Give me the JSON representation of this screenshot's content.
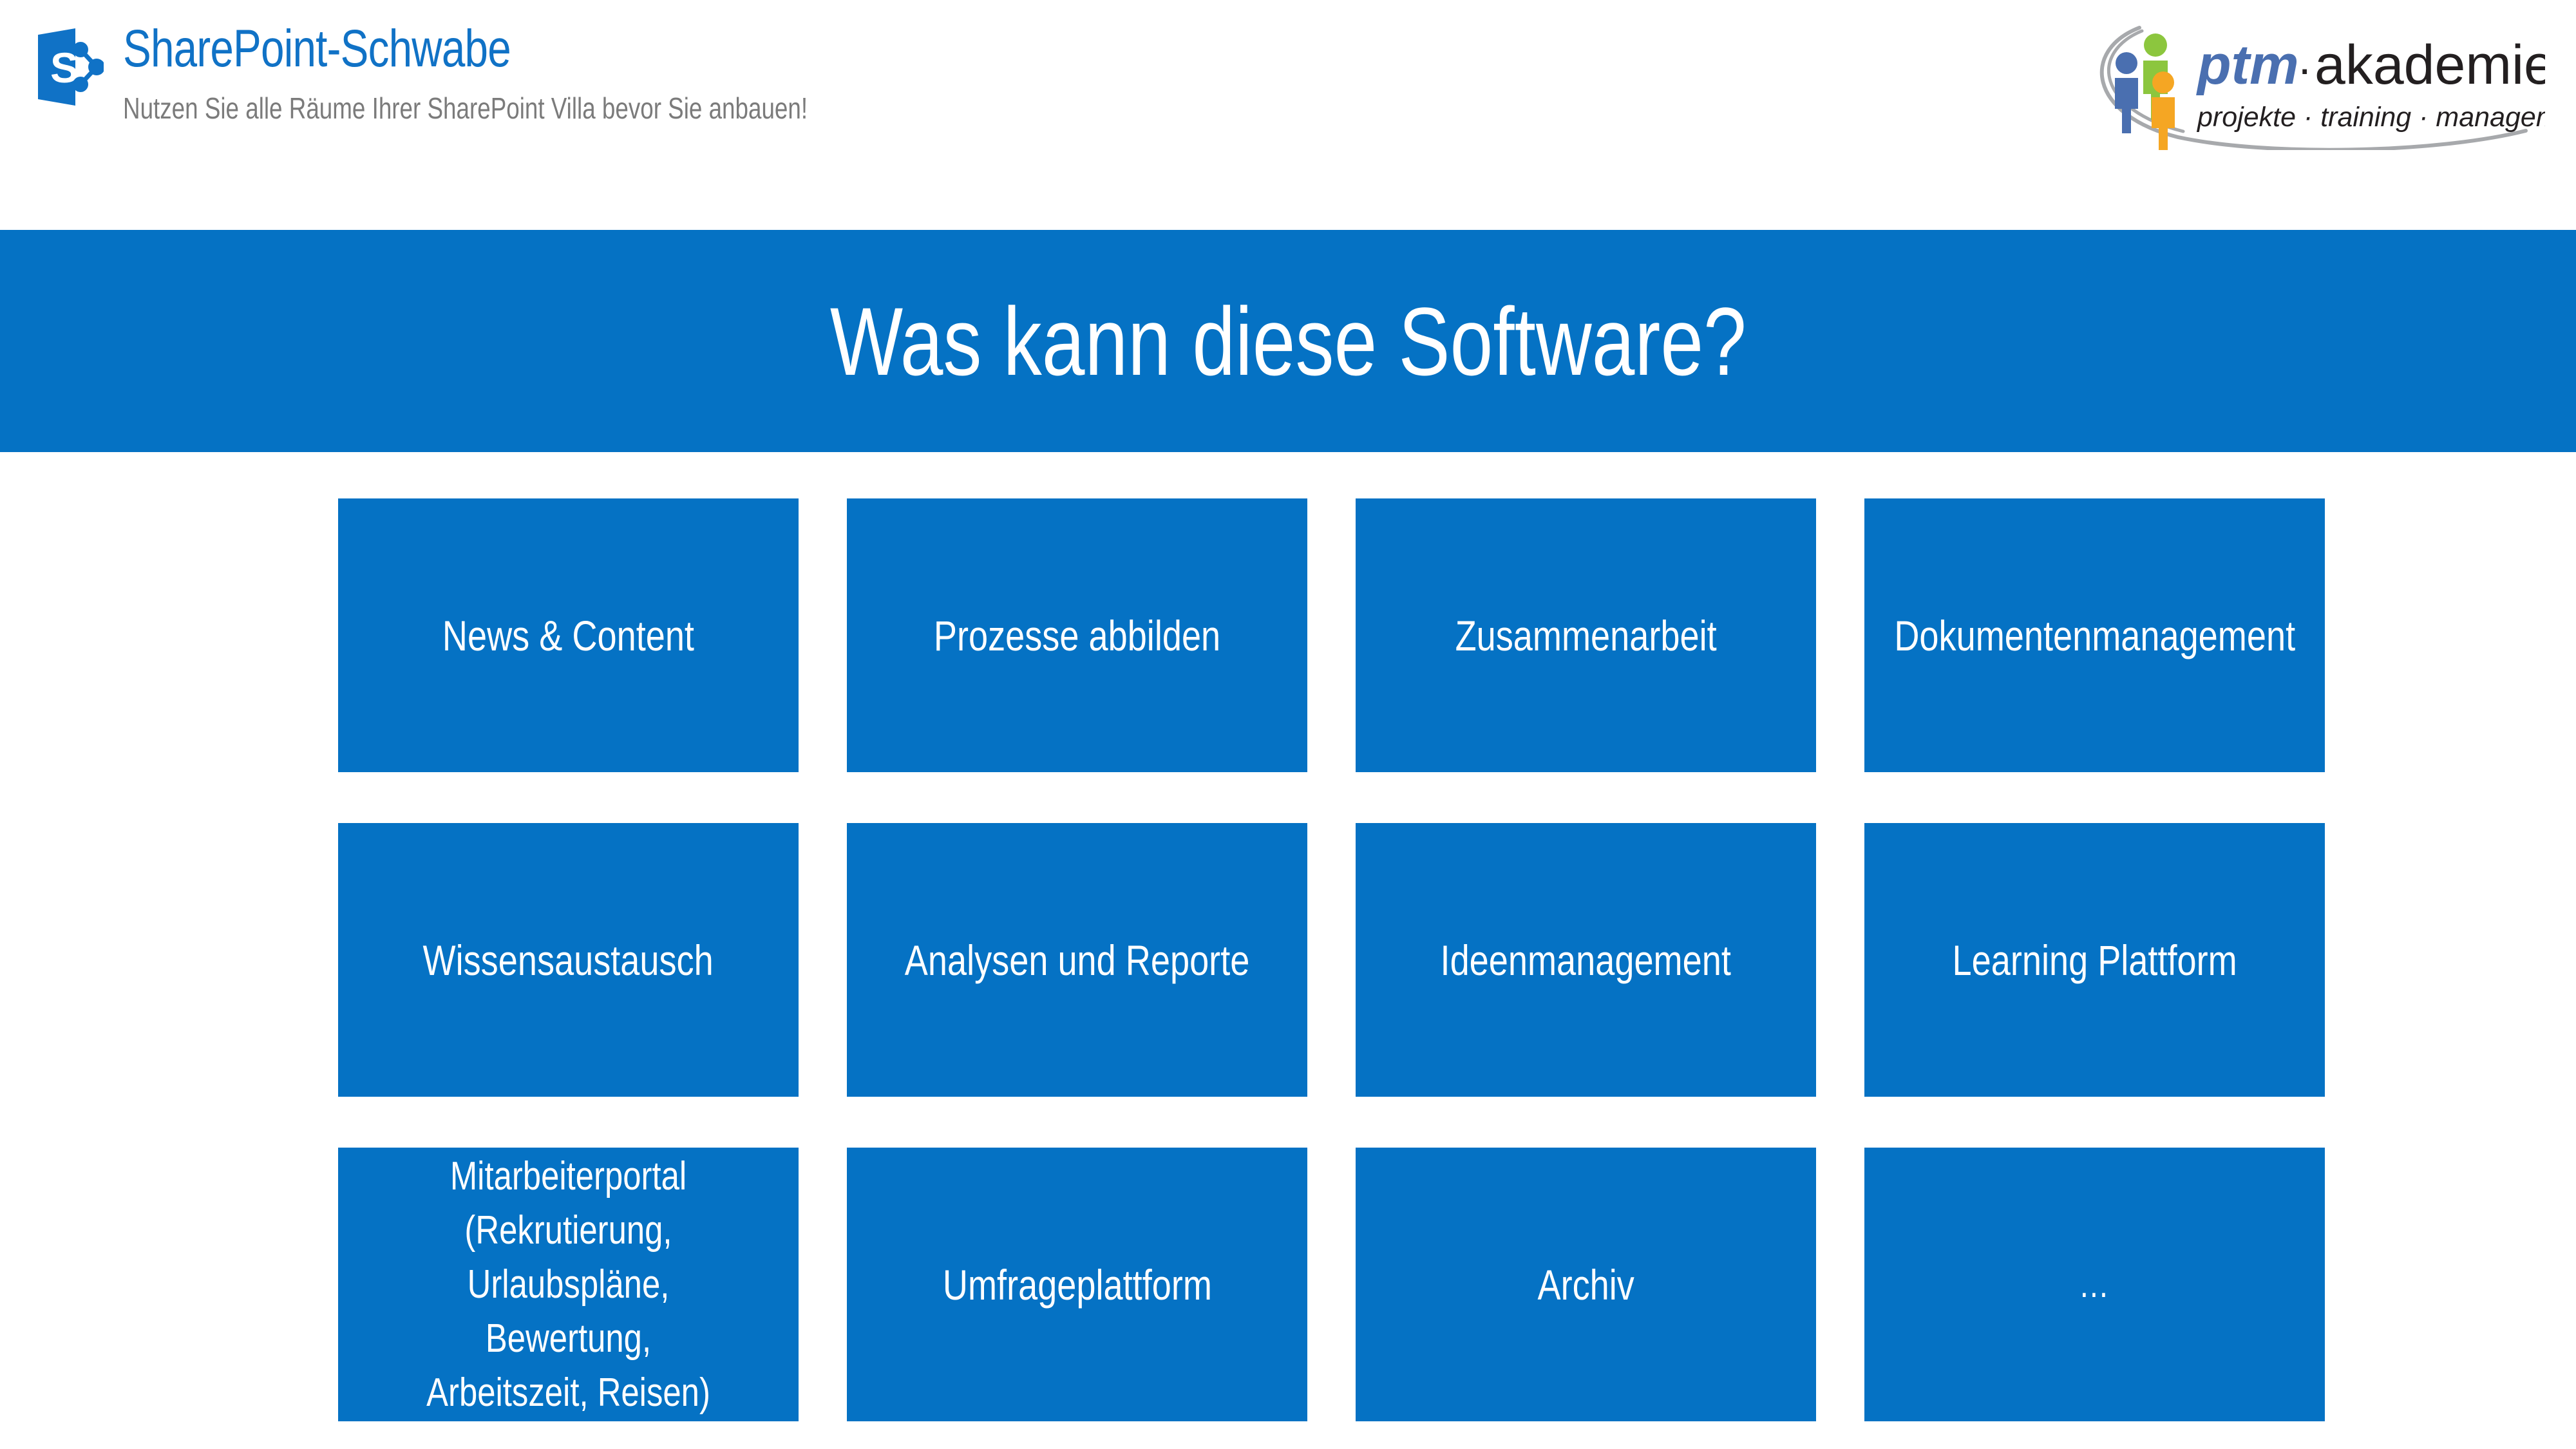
{
  "header": {
    "logo_icon": "sharepoint-icon",
    "title": "SharePoint-Schwabe",
    "subtitle": "Nutzen Sie alle Räume Ihrer SharePoint Villa bevor Sie anbauen!",
    "title_color": "#1072C6",
    "subtitle_color": "#7B7B7B"
  },
  "partner_logo": {
    "name_primary": "ptm",
    "name_separator": "·",
    "name_secondary": "akademie",
    "tagline": "projekte · training · management",
    "colors": {
      "ptm": "#4A6FB0",
      "akademie": "#231F20",
      "figure_green": "#8CC63E",
      "figure_blue": "#4A6FB0",
      "figure_orange": "#F5A623",
      "figure_green_dark": "#7AB828",
      "swoosh": "#A7A9AC"
    }
  },
  "banner": {
    "title": "Was kann diese Software?",
    "background": "#0572C4",
    "text_color": "#FFFFFF"
  },
  "tiles": {
    "background": "#0572C4",
    "text_color": "#FFFFFF",
    "columns": 4,
    "rows": 3,
    "items": [
      {
        "label": "News & Content",
        "multiline": false
      },
      {
        "label": "Prozesse abbilden",
        "multiline": false
      },
      {
        "label": "Zusammenarbeit",
        "multiline": false
      },
      {
        "label": "Dokumentenmanagement",
        "multiline": false
      },
      {
        "label": "Wissensaustausch",
        "multiline": false
      },
      {
        "label": "Analysen und Reporte",
        "multiline": false
      },
      {
        "label": "Ideenmanagement",
        "multiline": false
      },
      {
        "label": "Learning Plattform",
        "multiline": false
      },
      {
        "label": "Mitarbeiterportal\n(Rekrutierung,\nUrlaubspläne, Bewertung,\nArbeitszeit, Reisen)",
        "multiline": true
      },
      {
        "label": "Umfrageplattform",
        "multiline": false
      },
      {
        "label": "Archiv",
        "multiline": false
      },
      {
        "label": "…",
        "multiline": false,
        "ellipsis": true
      }
    ]
  }
}
